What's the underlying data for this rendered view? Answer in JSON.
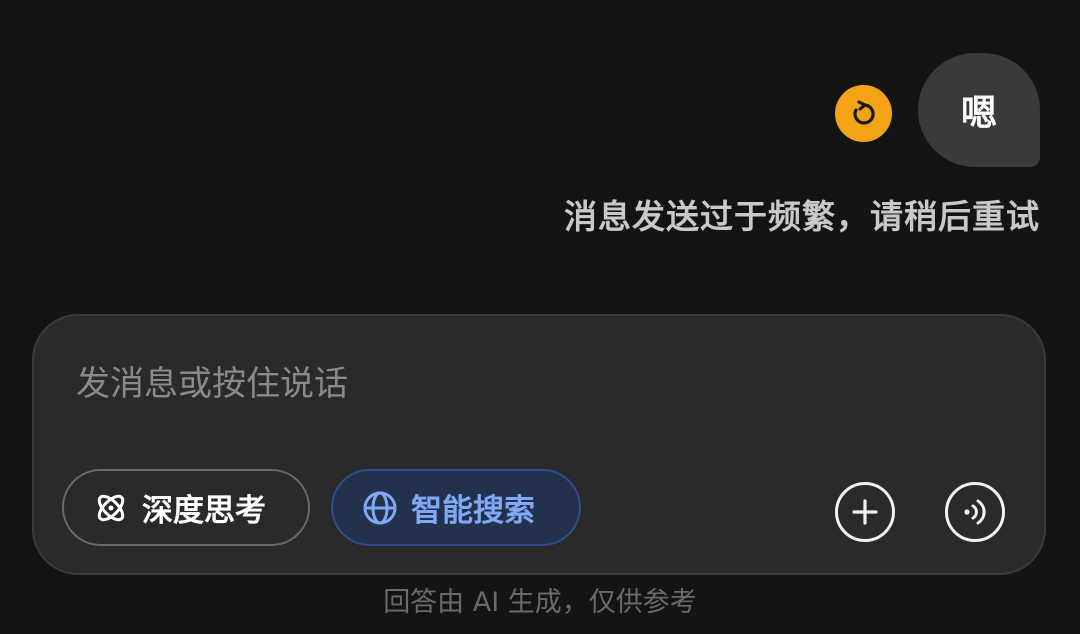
{
  "message": {
    "user_text": "嗯",
    "error_text": "消息发送过于频繁，请稍后重试",
    "retry_icon": "retry-icon",
    "retry_color": "#f5a316"
  },
  "composer": {
    "placeholder": "发消息或按住说话",
    "deep_think_label": "深度思考",
    "deep_think_icon": "atom-icon",
    "smart_search_label": "智能搜索",
    "smart_search_icon": "globe-icon",
    "smart_search_active": true,
    "accent": "#7fa8f5",
    "add_icon": "plus-icon",
    "voice_icon": "voice-call-icon"
  },
  "footer": {
    "disclaimer": "回答由 AI 生成，仅供参考"
  }
}
